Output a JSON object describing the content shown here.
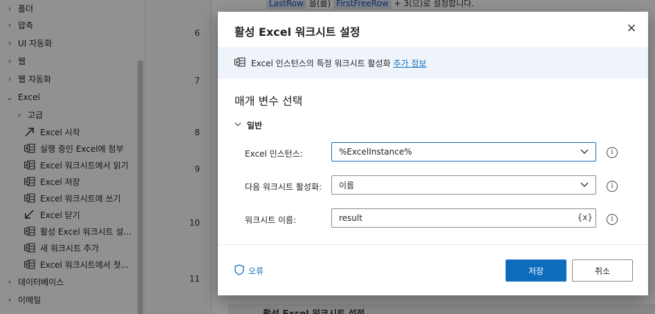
{
  "sidebar": {
    "items": [
      {
        "label": "폴더",
        "chevron": "›",
        "icon": ""
      },
      {
        "label": "압축",
        "chevron": "›",
        "icon": ""
      },
      {
        "label": "UI 자동화",
        "chevron": "›",
        "icon": ""
      },
      {
        "label": "웹",
        "chevron": "›",
        "icon": ""
      },
      {
        "label": "웹 자동화",
        "chevron": "›",
        "icon": ""
      },
      {
        "label": "Excel",
        "chevron": "⌄",
        "icon": ""
      },
      {
        "label": "고급",
        "chevron": "›",
        "icon": ""
      },
      {
        "label": "Excel 시작",
        "chevron": "",
        "icon": "launch-arrow-icon"
      },
      {
        "label": "실행 중인 Excel에 첨부",
        "chevron": "",
        "icon": "excel-icon"
      },
      {
        "label": "Excel 워크시트에서 읽기",
        "chevron": "",
        "icon": "excel-icon"
      },
      {
        "label": "Excel 저장",
        "chevron": "",
        "icon": "excel-icon"
      },
      {
        "label": "Excel 워크시트에 쓰기",
        "chevron": "",
        "icon": "excel-icon"
      },
      {
        "label": "Excel 닫기",
        "chevron": "",
        "icon": "close-arrow-icon"
      },
      {
        "label": "활성 Excel 워크시트 설...",
        "chevron": "",
        "icon": "excel-icon"
      },
      {
        "label": "새 워크시트 추가",
        "chevron": "",
        "icon": "excel-icon"
      },
      {
        "label": "Excel 워크시트에서 첫...",
        "chevron": "",
        "icon": "excel-icon"
      },
      {
        "label": "데이터베이스",
        "chevron": "›",
        "icon": ""
      },
      {
        "label": "이메일",
        "chevron": "›",
        "icon": ""
      }
    ]
  },
  "line_numbers": [
    "6",
    "7",
    "8",
    "9",
    "10",
    "11"
  ],
  "background_step": {
    "var1": "LastRow",
    "mid": "을(를)",
    "var2": "FirstFreeRow",
    "tail": "+ 3(으)로 설정합니다."
  },
  "background_next_title": "활성 Excel 워크시트 설정",
  "dialog": {
    "title": "활성 Excel 워크시트 설정",
    "info_text": "Excel 인스턴스의 특정 워크시트 활성화",
    "info_link": "추가 정보",
    "section_title": "매개 변수 선택",
    "group_label": "일반",
    "fields": [
      {
        "label": "Excel 인스턴스:",
        "value": "%ExcelInstance%",
        "control": "dropdown"
      },
      {
        "label": "다음 워크시트 활성화:",
        "value": "이름",
        "control": "dropdown"
      },
      {
        "label": "워크시트 이름:",
        "value": "result",
        "control": "text",
        "var_button": "{x}"
      }
    ],
    "error_label": "오류",
    "save_label": "저장",
    "cancel_label": "취소",
    "close_glyph": "×",
    "info_glyph": "i"
  },
  "colors": {
    "accent": "#0f6cbd",
    "info_bar": "#eff4fb",
    "excel_green": "#217346"
  }
}
